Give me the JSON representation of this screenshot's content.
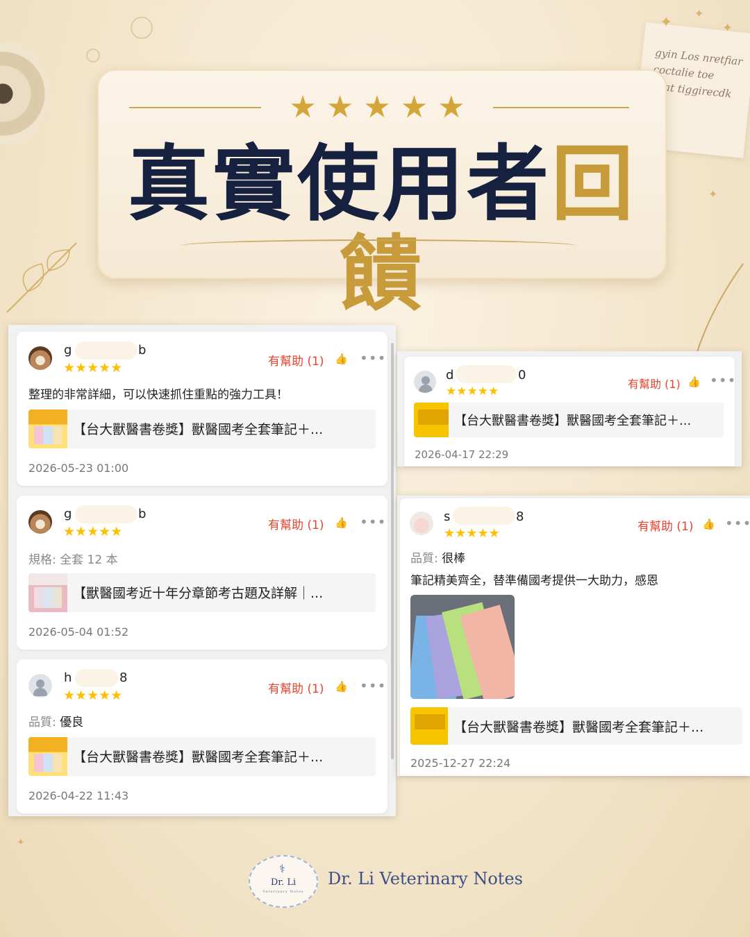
{
  "header": {
    "rating_stars": "★★★★★",
    "title_part1": "真實使用者",
    "title_part2": "回饋"
  },
  "decor": {
    "paper_lines": [
      "gyin Los nretfiar",
      "coctalie toe",
      "chat tiggirecdk"
    ]
  },
  "reviews_left": [
    {
      "user_first": "g",
      "user_last": "b",
      "stars": "★★★★★",
      "helpful": "有幫助 (1)",
      "more": "•••",
      "text": "整理的非常詳細，可以快速抓住重點的強力工具！",
      "product_title": "【台大獸醫書卷獎】獸醫國考全套筆記＋...",
      "date": "2026-05-23 01:00"
    },
    {
      "user_first": "g",
      "user_last": "b",
      "stars": "★★★★★",
      "helpful": "有幫助 (1)",
      "more": "•••",
      "spec_label": "規格:",
      "spec_value": "全套 12 本",
      "product_title": "【獸醫國考近十年分章節考古題及詳解｜...",
      "date": "2026-05-04 01:52"
    },
    {
      "user_first": "h",
      "user_last": "8",
      "stars": "★★★★★",
      "helpful": "有幫助 (1)",
      "more": "•••",
      "spec_label": "品質:",
      "spec_value": "優良",
      "product_title": "【台大獸醫書卷獎】獸醫國考全套筆記＋...",
      "date": "2026-04-22 11:43"
    }
  ],
  "reviews_right": [
    {
      "user_first": "d",
      "user_last": "0",
      "stars": "★★★★★",
      "helpful": "有幫助 (1)",
      "more": "•••",
      "product_title": "【台大獸醫書卷獎】獸醫國考全套筆記＋...",
      "date": "2026-04-17 22:29"
    },
    {
      "user_first": "s",
      "user_last": "8",
      "stars": "★★★★★",
      "helpful": "有幫助 (1)",
      "more": "•••",
      "spec_label": "品質:",
      "spec_value": "很棒",
      "text": "筆記精美齊全，替準備國考提供一大助力，感恩",
      "product_title": "【台大獸醫書卷獎】獸醫國考全套筆記＋...",
      "date": "2025-12-27 22:24"
    }
  ],
  "footer": {
    "logo_text": "Dr. Li",
    "logo_subtext": "Veterinary Notes",
    "brand": "Dr. Li Veterinary Notes"
  },
  "colors": {
    "navy": "#16213f",
    "gold": "#c79a3a",
    "helpful_red": "#e8432f",
    "star_yellow": "#ffbf00"
  }
}
